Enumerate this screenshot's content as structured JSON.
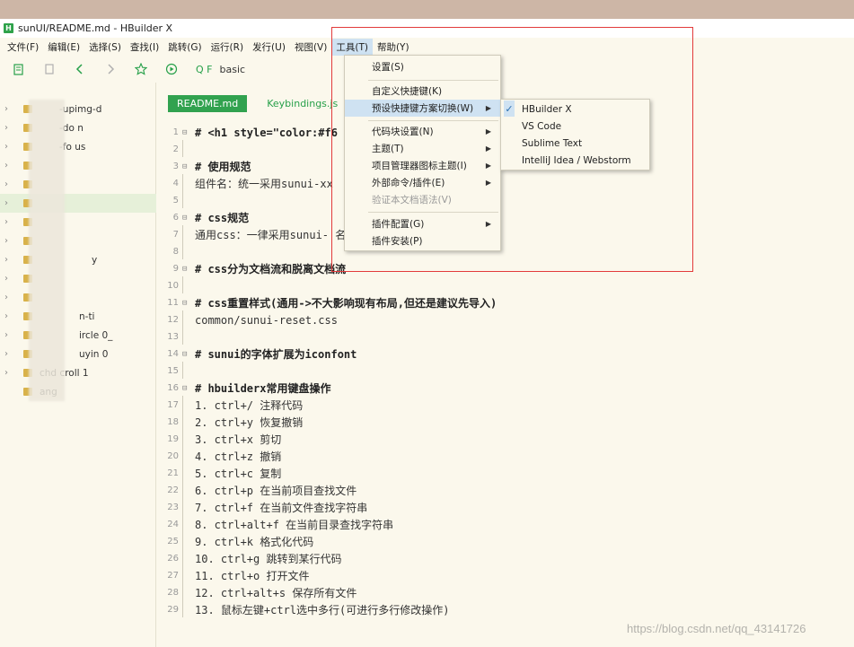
{
  "window": {
    "title": "sunUI/README.md - HBuilder X",
    "logo": "H"
  },
  "menubar": [
    "文件(F)",
    "编辑(E)",
    "选择(S)",
    "查找(I)",
    "跳转(G)",
    "运行(R)",
    "发行(U)",
    "视图(V)",
    "工具(T)",
    "帮助(Y)"
  ],
  "toolbar": {
    "search_prefix": "Q F",
    "search_value": "basic"
  },
  "sidebar": {
    "items": [
      "-upimg-d",
      "-do n",
      "-fo us",
      "",
      "",
      "",
      "",
      "",
      "y",
      "",
      "",
      "n-ti",
      "ircle 0_",
      "uyin 0",
      "chd croll 1",
      "ang"
    ]
  },
  "tabs": {
    "active": "README.md",
    "inactive": "Keybindings.js"
  },
  "code": [
    {
      "n": "1",
      "fold": "⊟",
      "text": "# <h1 style=\"color:#f6",
      "heading": true
    },
    {
      "n": "2",
      "fold": "",
      "text": "",
      "heading": false
    },
    {
      "n": "3",
      "fold": "⊟",
      "text": "# 使用规范",
      "heading": true
    },
    {
      "n": "4",
      "fold": "",
      "text": "组件名：统一采用sunui-xx",
      "heading": false
    },
    {
      "n": "5",
      "fold": "",
      "text": "",
      "heading": false
    },
    {
      "n": "6",
      "fold": "⊟",
      "text": "# css规范",
      "heading": true
    },
    {
      "n": "7",
      "fold": "",
      "text": "通用css：一律采用sunui-                         名为：sunui-xx",
      "heading": false
    },
    {
      "n": "8",
      "fold": "",
      "text": "",
      "heading": false
    },
    {
      "n": "9",
      "fold": "⊟",
      "text": "# css分为文档流和脱离文档流",
      "heading": true
    },
    {
      "n": "10",
      "fold": "",
      "text": "",
      "heading": false
    },
    {
      "n": "11",
      "fold": "⊟",
      "text": "# css重置样式(通用->不大影响现有布局,但还是建议先导入)",
      "heading": true
    },
    {
      "n": "12",
      "fold": "",
      "text": "common/sunui-reset.css",
      "heading": false
    },
    {
      "n": "13",
      "fold": "",
      "text": "",
      "heading": false
    },
    {
      "n": "14",
      "fold": "⊟",
      "text": "# sunui的字体扩展为iconfont",
      "heading": true
    },
    {
      "n": "15",
      "fold": "",
      "text": "",
      "heading": false
    },
    {
      "n": "16",
      "fold": "⊟",
      "text": "# hbuilderx常用键盘操作",
      "heading": true
    },
    {
      "n": "17",
      "fold": "",
      "text": "1. ctrl+/ 注释代码",
      "heading": false
    },
    {
      "n": "18",
      "fold": "",
      "text": "2. ctrl+y 恢复撤销",
      "heading": false
    },
    {
      "n": "19",
      "fold": "",
      "text": "3. ctrl+x 剪切",
      "heading": false
    },
    {
      "n": "20",
      "fold": "",
      "text": "4. ctrl+z 撤销",
      "heading": false
    },
    {
      "n": "21",
      "fold": "",
      "text": "5. ctrl+c 复制",
      "heading": false
    },
    {
      "n": "22",
      "fold": "",
      "text": "6. ctrl+p 在当前项目查找文件",
      "heading": false
    },
    {
      "n": "23",
      "fold": "",
      "text": "7. ctrl+f 在当前文件查找字符串",
      "heading": false
    },
    {
      "n": "24",
      "fold": "",
      "text": "8. ctrl+alt+f 在当前目录查找字符串",
      "heading": false
    },
    {
      "n": "25",
      "fold": "",
      "text": "9. ctrl+k 格式化代码",
      "heading": false
    },
    {
      "n": "26",
      "fold": "",
      "text": "10. ctrl+g 跳转到某行代码",
      "heading": false
    },
    {
      "n": "27",
      "fold": "",
      "text": "11. ctrl+o 打开文件",
      "heading": false
    },
    {
      "n": "28",
      "fold": "",
      "text": "12. ctrl+alt+s 保存所有文件",
      "heading": false
    },
    {
      "n": "29",
      "fold": "",
      "text": "13. 鼠标左键+ctrl选中多行(可进行多行修改操作)",
      "heading": false
    }
  ],
  "tools_menu": {
    "settings": "设置(S)",
    "custom_keys": "自定义快捷键(K)",
    "preset_keys": "预设快捷键方案切换(W)",
    "code_blocks": "代码块设置(N)",
    "theme": "主题(T)",
    "project_icons": "项目管理器图标主题(I)",
    "external": "外部命令/插件(E)",
    "validate": "验证本文档语法(V)",
    "plugin_config": "插件配置(G)",
    "plugin_install": "插件安装(P)"
  },
  "keymap_submenu": {
    "check": "✓",
    "items": [
      "HBuilder X",
      "VS Code",
      "Sublime Text",
      "IntelliJ Idea / Webstorm"
    ]
  },
  "watermark": "https://blog.csdn.net/qq_43141726"
}
